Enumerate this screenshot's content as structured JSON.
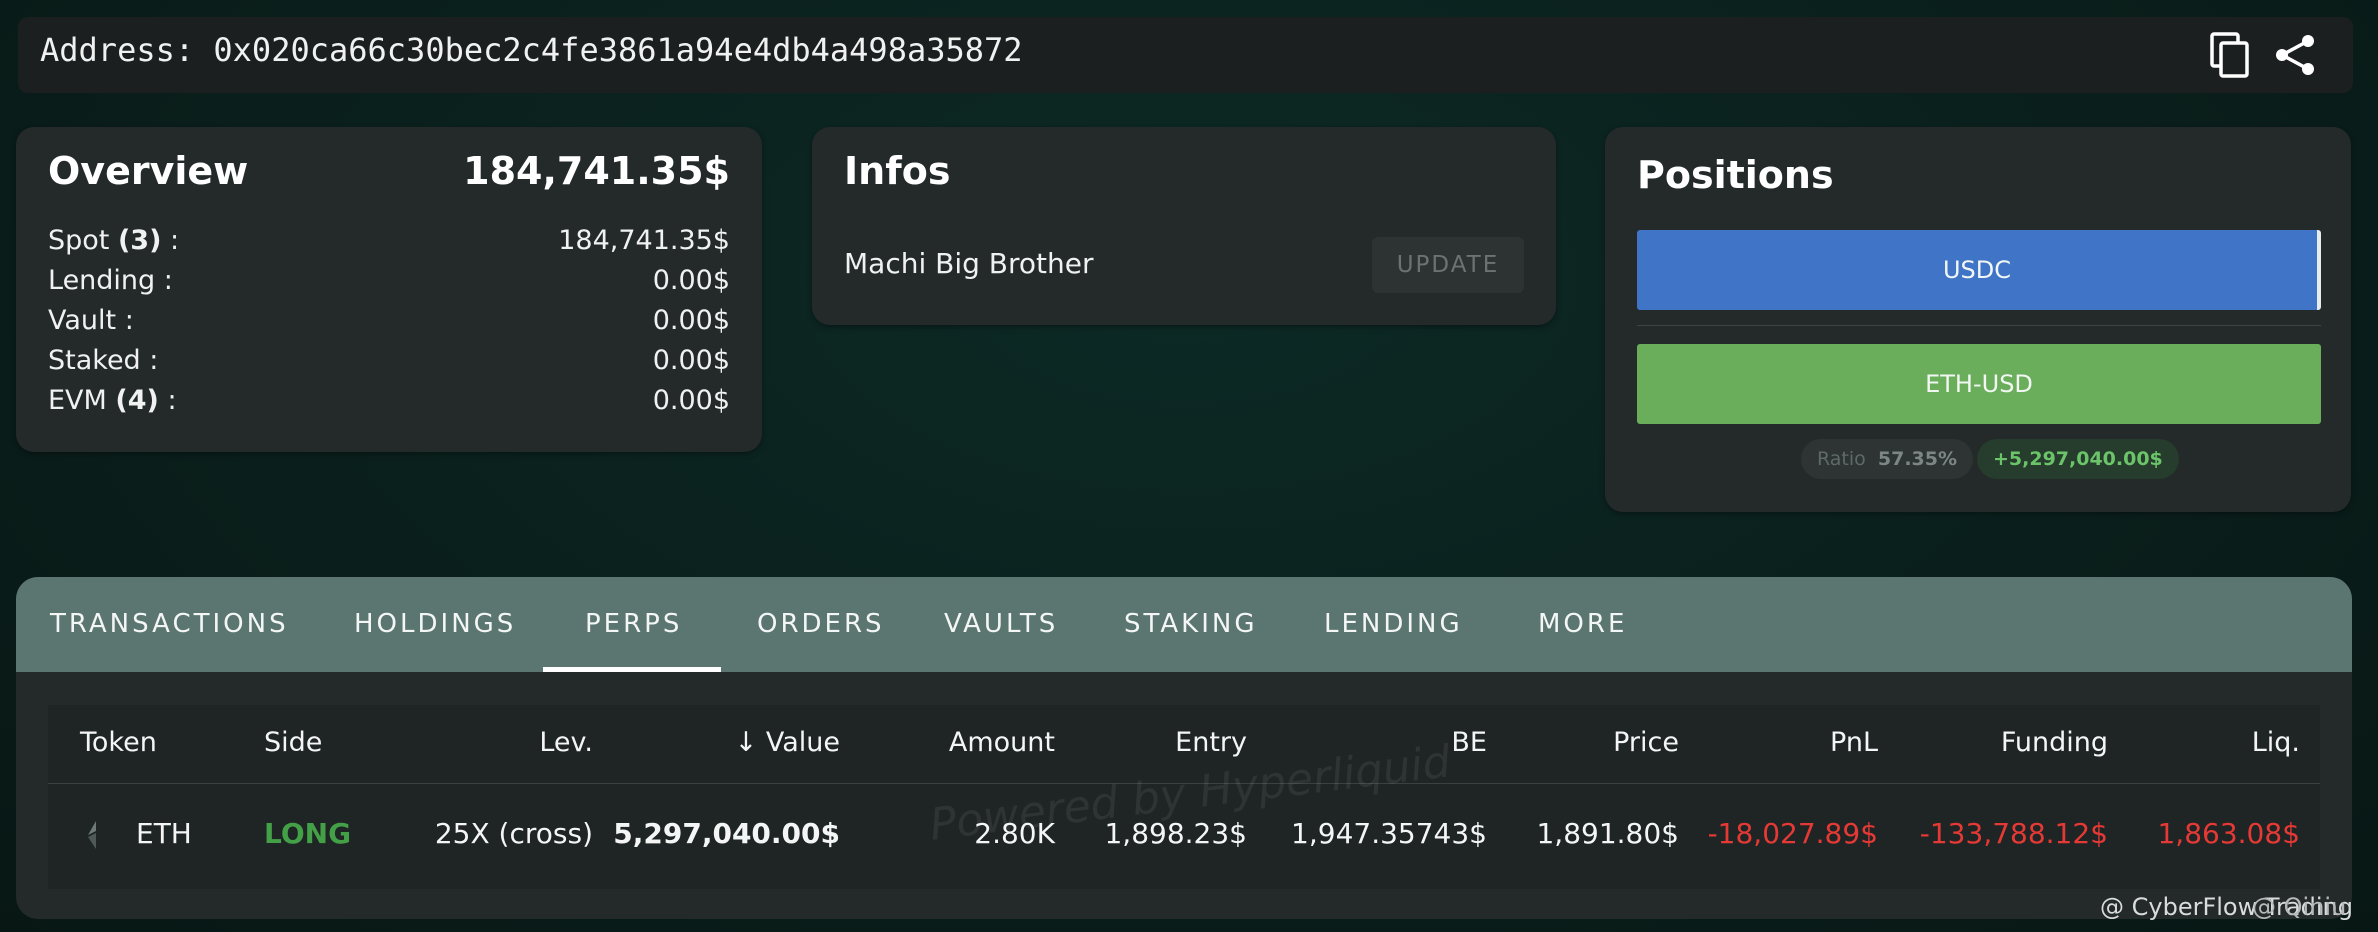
{
  "address": {
    "text": "Address: 0x020ca66c30bec2c4fe3861a94e4db4a498a35872"
  },
  "icons": {
    "copy": "copy-icon",
    "share": "share-icon",
    "eth": "ethereum-icon"
  },
  "overview": {
    "title": "Overview",
    "total": "184,741.35$",
    "rows": [
      {
        "label": "Spot ",
        "count": "(3)",
        "suffix": " :",
        "value": "184,741.35$"
      },
      {
        "label": "Lending :",
        "count": "",
        "suffix": "",
        "value": "0.00$"
      },
      {
        "label": "Vault :",
        "count": "",
        "suffix": "",
        "value": "0.00$"
      },
      {
        "label": "Staked :",
        "count": "",
        "suffix": "",
        "value": "0.00$"
      },
      {
        "label": "EVM ",
        "count": "(4)",
        "suffix": " :",
        "value": "0.00$"
      }
    ]
  },
  "infos": {
    "title": "Infos",
    "name": "Machi Big Brother",
    "update_label": "UPDATE"
  },
  "positions": {
    "title": "Positions",
    "bars": [
      {
        "label": "USDC",
        "color": "#3f74c6"
      },
      {
        "label": "ETH-USD",
        "color": "#6aad5b"
      }
    ],
    "ratio_label": "Ratio",
    "ratio_value": "57.35%",
    "pnl": "+5,297,040.00$"
  },
  "tabs": [
    "TRANSACTIONS",
    "HOLDINGS",
    "PERPS",
    "ORDERS",
    "VAULTS",
    "STAKING",
    "LENDING",
    "MORE"
  ],
  "active_tab": "PERPS",
  "table": {
    "headers": [
      "Token",
      "Side",
      "Lev.",
      "Value",
      "Amount",
      "Entry",
      "BE",
      "Price",
      "PnL",
      "Funding",
      "Liq."
    ],
    "sort_indicator": "↓",
    "rows": [
      {
        "token": "ETH",
        "side": "LONG",
        "lev": "25X (cross)",
        "value": "5,297,040.00$",
        "amount": "2.80K",
        "entry": "1,898.23$",
        "be": "1,947.35743$",
        "price": "1,891.80$",
        "pnl": "-18,027.89$",
        "funding": "-133,788.12$",
        "liq": "1,863.08$"
      }
    ]
  },
  "watermark": "Powered by Hyperliquid",
  "credit": "@ CyberFlow Trading",
  "credit_overlay": "@ Qiniu",
  "colors": {
    "long": "#43a047",
    "negative": "#e53935",
    "positive": "#6cc46a",
    "tab_bar": "#5b7671"
  }
}
